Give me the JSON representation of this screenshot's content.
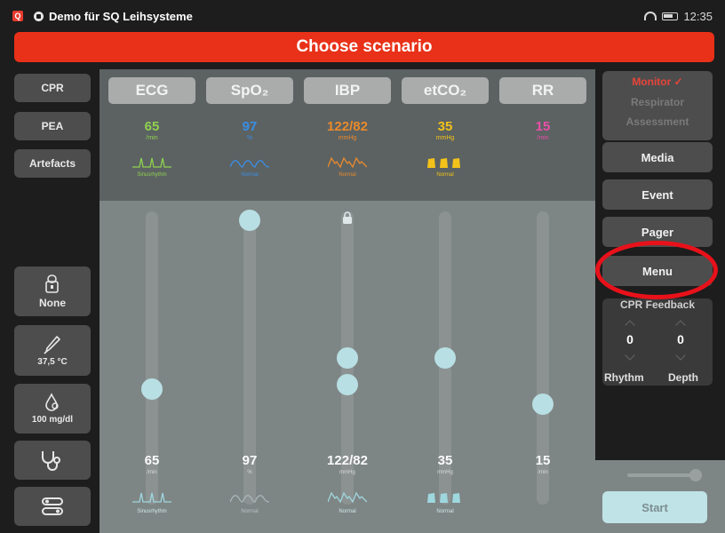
{
  "status_bar": {
    "app_badge": "Q",
    "title": "Demo für SQ Leihsysteme",
    "time": "12:35"
  },
  "banner": "Choose scenario",
  "left_buttons": {
    "cpr": "CPR",
    "pea": "PEA",
    "artefacts": "Artefacts"
  },
  "left_tools": {
    "monitor_lock": "None",
    "temperature": "37,5 °C",
    "glucose": "100 mg/dl"
  },
  "params": [
    {
      "tab": "ECG",
      "value": "65",
      "unit": "/min",
      "wave_label": "Sinusrhythm",
      "color": "#8fd14f",
      "wave": "ecg-wave-icon"
    },
    {
      "tab": "SpO₂",
      "value": "97",
      "unit": "%",
      "wave_label": "Normal",
      "color": "#3a8ee6",
      "wave": "pleth-wave-icon"
    },
    {
      "tab": "IBP",
      "value": "122/82",
      "unit": "mmHg",
      "wave_label": "Normal",
      "color": "#ea8a2c",
      "wave": "pressure-wave-icon"
    },
    {
      "tab": "etCO₂",
      "value": "35",
      "unit": "mmHg",
      "wave_label": "Normal",
      "color": "#f2c21a",
      "wave": "capno-wave-icon"
    },
    {
      "tab": "RR",
      "value": "15",
      "unit": "/min",
      "wave_label": "",
      "color": "#e84fa8",
      "wave": ""
    }
  ],
  "bottom_values": [
    {
      "value": "65",
      "unit": "/min",
      "wave_label": "Sinusrhythm"
    },
    {
      "value": "97",
      "unit": "%",
      "wave_label": "Normal"
    },
    {
      "value": "122/82",
      "unit": "mmHg",
      "wave_label": "Normal"
    },
    {
      "value": "35",
      "unit": "mmHg",
      "wave_label": "Normal"
    },
    {
      "value": "15",
      "unit": "/min",
      "wave_label": ""
    }
  ],
  "mode_box": {
    "monitor": "Monitor ✓",
    "respirator": "Respirator",
    "assessment": "Assessment"
  },
  "right_buttons": {
    "media": "Media",
    "event": "Event",
    "pager": "Pager",
    "menu": "Menu"
  },
  "cpr_feedback": {
    "title": "CPR Feedback",
    "rhythm_value": "0",
    "depth_value": "0",
    "rhythm_label": "Rhythm",
    "depth_label": "Depth"
  },
  "start": "Start",
  "colors": {
    "banner": "#e83118",
    "highlight_ring": "#e8111a",
    "start_button": "#bfe3e7",
    "knob": "#b8dfe4"
  }
}
